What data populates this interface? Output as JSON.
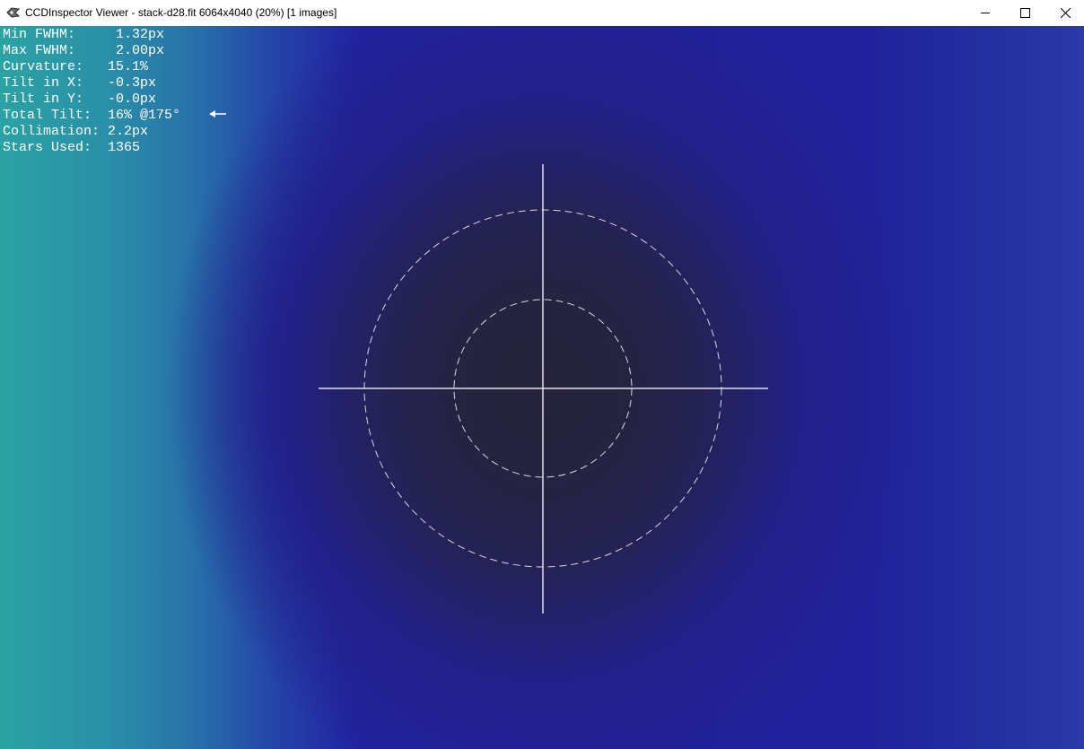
{
  "window": {
    "title": "CCDInspector Viewer - stack-d28.fit 6064x4040 (20%)  [1 images]",
    "icon": "ccdinspector-app-icon",
    "controls": {
      "minimize": "minimize-icon",
      "maximize": "maximize-icon",
      "close": "close-icon"
    }
  },
  "stats": [
    {
      "label": "Min FWHM:     ",
      "value": "1.32px"
    },
    {
      "label": "Max FWHM:     ",
      "value": "2.00px"
    },
    {
      "label": "Curvature:   ",
      "value": "15.1%"
    },
    {
      "label": "Tilt in X:   ",
      "value": "-0.3px"
    },
    {
      "label": "Tilt in Y:   ",
      "value": "-0.0px"
    },
    {
      "label": "Total Tilt:  ",
      "value": "16% @175°"
    },
    {
      "label": "Collimation: ",
      "value": "2.2px"
    },
    {
      "label": "Stars Used:  ",
      "value": "1365"
    }
  ],
  "tilt_arrow_icon": "left-arrow-icon",
  "colors": {
    "text": "#ffffff",
    "overlay": "#d8d8e0",
    "center": "#25233a",
    "edge_left": "#2aa3a3",
    "edge_mid": "#2222a0"
  }
}
